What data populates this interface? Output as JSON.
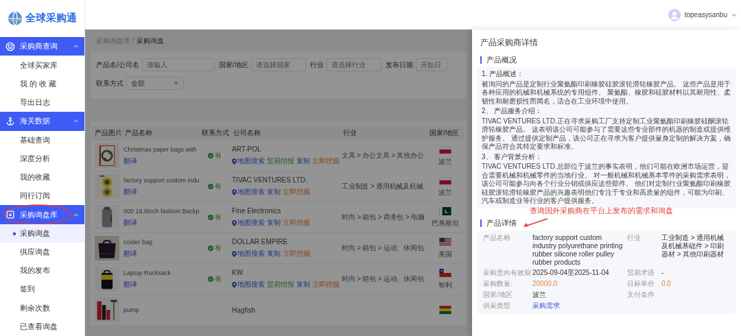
{
  "logo": {
    "text": "全球采购通"
  },
  "user": {
    "name": "topeasysanbu"
  },
  "sidebar": {
    "groups": [
      {
        "title": "采购商查询",
        "expanded": true,
        "circled": false,
        "items": [
          {
            "label": "全球买家库",
            "selected": false
          },
          {
            "label": "我 的 收 藏",
            "selected": false
          },
          {
            "label": "导出日志",
            "selected": false
          }
        ]
      },
      {
        "title": "海关数据",
        "expanded": true,
        "circled": false,
        "items": [
          {
            "label": "基础查询",
            "selected": false
          },
          {
            "label": "深度分析",
            "selected": false
          },
          {
            "label": "我的收藏",
            "selected": false
          },
          {
            "label": "同行订阅",
            "selected": false
          }
        ]
      },
      {
        "title": "采购询盘库",
        "expanded": true,
        "circled": true,
        "items": [
          {
            "label": "采购询盘",
            "selected": true
          },
          {
            "label": "供应询盘",
            "selected": false
          },
          {
            "label": "我的发布",
            "selected": false
          },
          {
            "label": "签到",
            "selected": false
          },
          {
            "label": "剩余次数",
            "selected": false
          },
          {
            "label": "已查看询盘",
            "selected": false
          }
        ]
      }
    ]
  },
  "breadcrumb": {
    "items": [
      "采购询盘库",
      "采购询盘"
    ],
    "separator": "/"
  },
  "filters": [
    {
      "kind": "input",
      "label": "产品名/公司名",
      "placeholder": "请输入"
    },
    {
      "kind": "input",
      "label": "国家/地区",
      "placeholder": "请选择国家"
    },
    {
      "kind": "input",
      "label": "行业",
      "placeholder": "请选择行业"
    },
    {
      "kind": "input",
      "label": "发布日期",
      "placeholder": "开始日"
    },
    {
      "kind": "select",
      "label": "联系方式",
      "value": "全部"
    }
  ],
  "table": {
    "columns": [
      "产品图片",
      "产品名称",
      "联系方式",
      "公司名称",
      "行业",
      "国家/地区"
    ],
    "rows": [
      {
        "product": "Christmas paper bags with",
        "translate": "翻译",
        "contact": "有",
        "company": "ART-POL",
        "actions": [
          {
            "kind": "map",
            "label": "地图搜索"
          },
          {
            "kind": "intel",
            "label": "贸易情报"
          },
          {
            "kind": "copy",
            "label": "复制"
          },
          {
            "kind": "dig",
            "label": "立即挖掘"
          }
        ],
        "industry": "文具 > 办公文具 > 其他办公",
        "flag": {
          "kind": "pl"
        },
        "country": "波兰"
      },
      {
        "product": "factory support custom indu",
        "translate": "翻译",
        "contact": "有",
        "company": "TIVAC VENTURES LTD.",
        "actions": [
          {
            "kind": "map",
            "label": "地图搜索"
          },
          {
            "kind": "copy",
            "label": "复制"
          },
          {
            "kind": "dig",
            "label": "立即挖掘"
          }
        ],
        "industry": "工业制造 > 通用机械及机械",
        "flag": {
          "kind": "pl"
        },
        "country": "波兰"
      },
      {
        "product": "000 15.6inch fashion Backp",
        "translate": "翻译",
        "contact": "有",
        "company": "Fine Electronics",
        "actions": [
          {
            "kind": "map",
            "label": "地图搜索"
          },
          {
            "kind": "copy",
            "label": "复制"
          },
          {
            "kind": "dig",
            "label": "立即挖掘"
          }
        ],
        "industry": "时尚 > 箱包 > 商务包 > 电脑",
        "flag": {
          "kind": "pk"
        },
        "country": "巴基斯坦"
      },
      {
        "product": "cooler bag",
        "translate": "翻译",
        "contact": "有",
        "company": "DOLLAR EMPIRE",
        "actions": [
          {
            "kind": "map",
            "label": "地图搜索"
          },
          {
            "kind": "copy",
            "label": "复制"
          },
          {
            "kind": "dig",
            "label": "立即挖掘"
          }
        ],
        "industry": "时尚 > 箱包 > 运动、休闲包",
        "flag": {
          "kind": "us"
        },
        "country": "美国"
      },
      {
        "product": "Laptop Rucksack",
        "translate": "翻译",
        "contact": "有",
        "company": "KW",
        "actions": [
          {
            "kind": "map",
            "label": "地图搜索"
          },
          {
            "kind": "intel",
            "label": "贸易情报"
          },
          {
            "kind": "copy",
            "label": "复制"
          },
          {
            "kind": "dig",
            "label": "立即挖掘"
          }
        ],
        "industry": "时尚 > 箱包 > 运动、休闲包",
        "flag": {
          "kind": "cl"
        },
        "country": "智利"
      },
      {
        "product": "pump",
        "company": "Hagfish",
        "actions": [],
        "flag": {
          "kind": "bo"
        }
      }
    ]
  },
  "drawer": {
    "title": "产品采购商详情",
    "overview": {
      "title": "产品概况",
      "paragraphs": [
        {
          "kind": "heading",
          "text": "1. 产品概述："
        },
        {
          "kind": "body",
          "text": "被询问的产品是定制行业聚氨酯印刷橡胶硅胶滚轮滑轮橡胶产品。 这些产品是用于各种应用的机械和机械系统的专用组件。 聚氨酯、橡胶和硅胶材料以其耐用性、柔韧性和耐磨损性而闻名，适合在工业环境中使用。"
        },
        {
          "kind": "heading",
          "text": "2、 产品服务介绍："
        },
        {
          "kind": "body",
          "text": "TIVAC VENTURES LTD.正在寻求采购工厂支持定制工业聚氨酯印刷橡胶硅酮滚轮滑轮橡胶产品。 这表明该公司可能参与了需要这些专业部件的机器的制造或提供维护服务。 通过提供定制产品，该公司正在寻求为客户提供量身定制的解决方案，确保产品符合其特定要求和标准。"
        },
        {
          "kind": "heading",
          "text": "3、 客户背景分析："
        },
        {
          "kind": "body",
          "text": "TIVAC VENTURES LTD.总部位于波兰的事实表明，他们可能在欧洲市场运营，迎合需要机械和机械零件的当地行业。 对一般机械和机械基本零件的采购需求表明，该公司可能参与向各个行业分销或供应这些部件。 他们对定制行业聚氨酯印刷橡胶硅胶滚轮滑轮橡胶产品的兴趣表明他们专注于专业和高质量的组件，可能为印刷、汽车或制造业等行业的客户提供服务。"
        }
      ]
    },
    "annotation": "查询国外采购商在平台上发布的需求和询盘",
    "details": {
      "title": "产品详情",
      "fields": [
        {
          "label": "产品名称",
          "value": "factory support custom industry polyurethane printing rubber silicone roller pulley rubber products",
          "kind": "text"
        },
        {
          "label": "行业",
          "value": "工业制造 > 通用机械及机械基础件 > 印刷器材 > 其他印刷器材",
          "kind": "text"
        },
        {
          "label": "采购意向有效期",
          "value": "2025-09-04至2025-11-04",
          "kind": "text"
        },
        {
          "label": "贸易术语",
          "value": "-",
          "kind": "text"
        },
        {
          "label": "采购数量:",
          "value": "20000.0",
          "kind": "number"
        },
        {
          "label": "目标单价",
          "value": "0.0",
          "kind": "number"
        },
        {
          "label": "国家/地区",
          "value": "波兰",
          "kind": "text"
        },
        {
          "label": "支付条件",
          "kind": "text"
        },
        {
          "label": "供采类型",
          "value": "采购需求",
          "kind": "link"
        }
      ]
    }
  }
}
